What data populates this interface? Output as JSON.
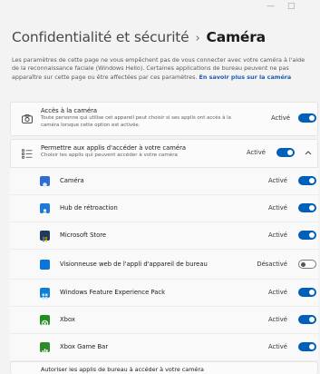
{
  "window": {
    "controls": [
      "—",
      "□"
    ]
  },
  "breadcrumb": {
    "parent": "Confidentialité et sécurité",
    "separator": "›",
    "current": "Caméra"
  },
  "description": {
    "text": "Les paramètres de cette page ne vous empêchent pas de vous connecter avec votre caméra à l'aide de la reconnaissance faciale (Windows Hello). Certaines applications de bureau peuvent ne pas apparaître sur cette page ou être affectées par ces paramètres.",
    "link": "En savoir plus sur la caméra"
  },
  "camera_access": {
    "title": "Accès à la caméra",
    "subtitle": "Toute personne qui utilise cet appareil peut choisir si ses applis ont accès à la caméra lorsque cette option est activée.",
    "state": "Activé",
    "on": true
  },
  "apps_access": {
    "title": "Permettre aux applis d'accéder à votre caméra",
    "subtitle": "Choisir les applis qui peuvent accéder à votre caméra",
    "state": "Activé",
    "on": true
  },
  "apps": [
    {
      "name": "Caméra",
      "state": "Activé",
      "on": true,
      "icon": "camera-app-icon",
      "color": "#2f6bd0"
    },
    {
      "name": "Hub de rétroaction",
      "state": "Activé",
      "on": true,
      "icon": "feedback-hub-icon",
      "color": "#1e7ad6"
    },
    {
      "name": "Microsoft Store",
      "state": "Activé",
      "on": true,
      "icon": "store-icon",
      "color": "#1f3a5c"
    },
    {
      "name": "Visionneuse web de l'appli d'appareil de bureau",
      "state": "Désactivé",
      "on": false,
      "icon": "webview-icon",
      "color": "#0a74d8"
    },
    {
      "name": "Windows Feature Experience Pack",
      "state": "Activé",
      "on": true,
      "icon": "feature-pack-icon",
      "color": "#0e7fd1"
    },
    {
      "name": "Xbox",
      "state": "Activé",
      "on": true,
      "icon": "xbox-icon",
      "color": "#1f8f1f"
    },
    {
      "name": "Xbox Game Bar",
      "state": "Activé",
      "on": true,
      "icon": "game-bar-icon",
      "color": "#2f8a2f"
    }
  ],
  "desktop_apps_partial": "Autoriser les applis de bureau à accéder à votre caméra",
  "colors": {
    "accent": "#005fb8",
    "link": "#1a5fb4"
  }
}
